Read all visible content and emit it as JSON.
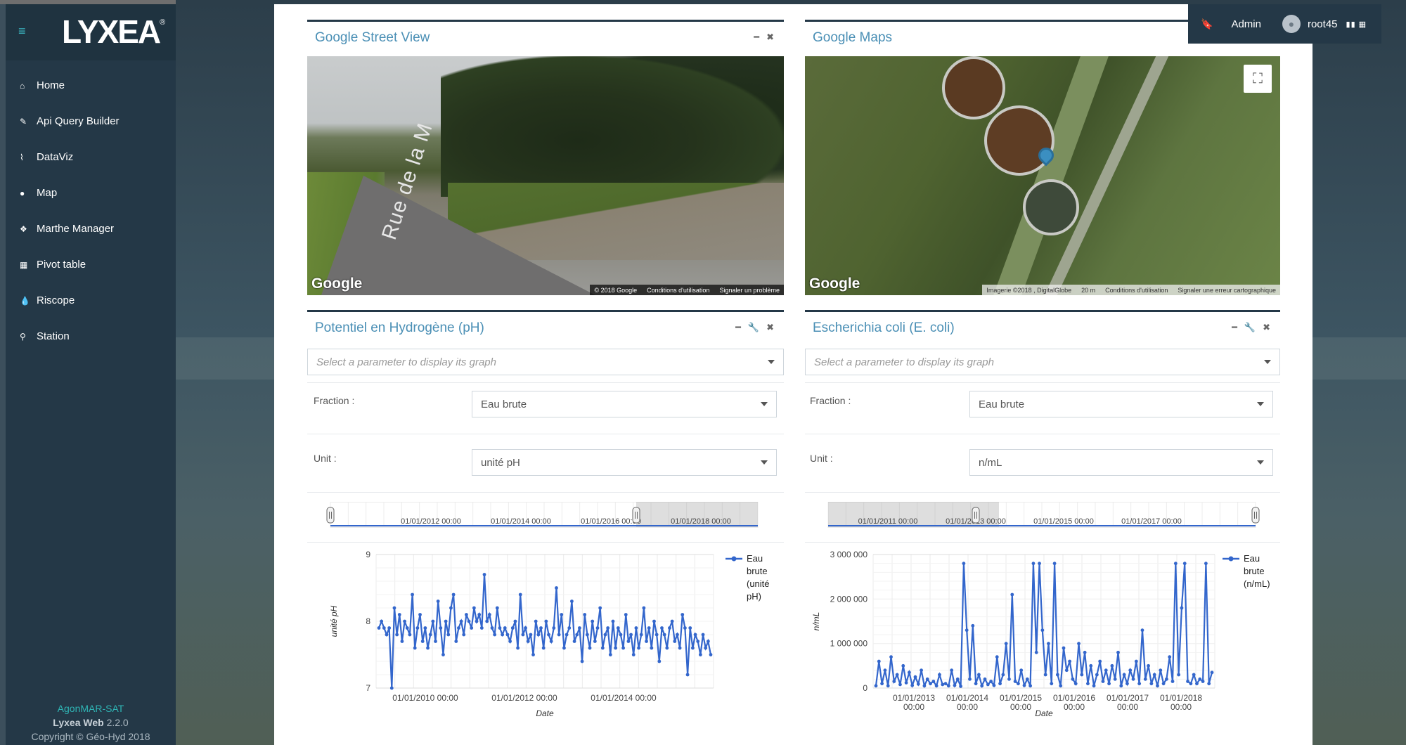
{
  "app": {
    "logo": "LYXEA",
    "project": "AgonMAR-SAT",
    "product": "Lyxea Web",
    "version": "2.2.0",
    "copyright": "Copyright © Géo-Hyd 2018"
  },
  "sidebar": {
    "items": [
      {
        "label": "Home",
        "icon": "home-icon"
      },
      {
        "label": "Api Query Builder",
        "icon": "edit-icon"
      },
      {
        "label": "DataViz",
        "icon": "line-chart-icon"
      },
      {
        "label": "Map",
        "icon": "globe-icon"
      },
      {
        "label": "Marthe Manager",
        "icon": "cubes-icon"
      },
      {
        "label": "Pivot table",
        "icon": "table-icon"
      },
      {
        "label": "Riscope",
        "icon": "drop-icon"
      },
      {
        "label": "Station",
        "icon": "map-marker-icon"
      }
    ]
  },
  "userbar": {
    "role": "Admin",
    "username": "root45"
  },
  "widgets": {
    "streetview": {
      "title": "Google Street View",
      "google": "Google",
      "attr": [
        "© 2018 Google",
        "Conditions d'utilisation",
        "Signaler un problème"
      ],
      "street": "Rue de la M"
    },
    "maps": {
      "title": "Google Maps",
      "google": "Google",
      "attr": [
        "Imagerie ©2018 , DigitalGlobe",
        "20 m",
        "Conditions d'utilisation",
        "Signaler une erreur cartographique"
      ]
    },
    "ph": {
      "title": "Potentiel en Hydrogène (pH)",
      "param_placeholder": "Select a parameter to display its graph",
      "fraction_label": "Fraction :",
      "fraction_value": "Eau brute",
      "unit_label": "Unit :",
      "unit_value": "unité pH",
      "navigator_labels": [
        "01/01/2012 00:00",
        "01/01/2014 00:00",
        "01/01/2016 00:00",
        "01/01/2018 00:00"
      ]
    },
    "ecoli": {
      "title": "Escherichia coli (E. coli)",
      "param_placeholder": "Select a parameter to display its graph",
      "fraction_label": "Fraction :",
      "fraction_value": "Eau brute",
      "unit_label": "Unit :",
      "unit_value": "n/mL",
      "navigator_labels": [
        "01/01/2011 00:00",
        "01/01/2013 00:00",
        "01/01/2015 00:00",
        "01/01/2017 00:00"
      ]
    }
  },
  "chart_data": [
    {
      "type": "line",
      "ylabel": "unité pH",
      "xlabel": "Date",
      "ylim": [
        7,
        9
      ],
      "yticks": [
        "9",
        "8",
        "7"
      ],
      "xticks": [
        "01/01/2010 00:00",
        "01/01/2012 00:00",
        "01/01/2014 00:00"
      ],
      "color": "#3366cc",
      "series": [
        {
          "name": "Eau brute (unité pH)",
          "values": [
            7.9,
            8.0,
            7.9,
            7.8,
            7.9,
            7.0,
            8.2,
            7.8,
            8.1,
            7.7,
            8.0,
            7.9,
            7.8,
            8.4,
            7.6,
            7.9,
            8.1,
            7.7,
            7.9,
            7.6,
            7.8,
            8.0,
            7.7,
            8.3,
            7.9,
            7.5,
            8.0,
            7.8,
            8.2,
            8.4,
            7.7,
            7.9,
            8.0,
            7.8,
            8.1,
            8.0,
            7.9,
            8.2,
            8.0,
            8.1,
            7.9,
            8.7,
            8.0,
            8.1,
            7.9,
            7.8,
            8.2,
            7.9,
            7.8,
            7.9,
            7.8,
            7.7,
            7.9,
            8.0,
            7.6,
            8.4,
            7.8,
            7.9,
            7.7,
            7.8,
            7.5,
            8.0,
            7.8,
            7.9,
            7.6,
            8.0,
            7.8,
            7.7,
            7.9,
            8.5,
            7.8,
            8.1,
            7.6,
            7.8,
            7.9,
            8.3,
            7.7,
            7.8,
            7.9,
            7.4,
            8.1,
            7.8,
            7.6,
            8.0,
            7.7,
            7.9,
            8.2,
            7.6,
            7.8,
            7.9,
            7.5,
            8.0,
            7.6,
            7.9,
            7.8,
            7.6,
            8.1,
            7.7,
            7.8,
            7.5,
            7.9,
            7.6,
            7.8,
            8.2,
            7.7,
            7.9,
            7.6,
            8.0,
            7.8,
            7.4,
            7.9,
            7.8,
            7.6,
            7.9,
            8.0,
            7.7,
            7.8,
            7.6,
            8.1,
            7.9,
            7.2,
            7.9,
            7.6,
            7.8,
            7.7,
            7.5,
            7.8,
            7.6,
            7.7,
            7.5
          ]
        }
      ]
    },
    {
      "type": "line",
      "ylabel": "n/mL",
      "xlabel": "Date",
      "ylim": [
        0,
        3000000
      ],
      "yticks": [
        "3 000 000",
        "2 000 000",
        "1 000 000",
        "0"
      ],
      "xticks": [
        "01/01/2013\n00:00",
        "01/01/2014\n00:00",
        "01/01/2015\n00:00",
        "01/01/2016\n00:00",
        "01/01/2017\n00:00",
        "01/01/2018\n00:00"
      ],
      "color": "#3366cc",
      "series": [
        {
          "name": "Eau brute (n/mL)",
          "values": [
            50000,
            600000,
            100000,
            400000,
            50000,
            700000,
            150000,
            300000,
            80000,
            500000,
            120000,
            350000,
            60000,
            250000,
            90000,
            400000,
            50000,
            200000,
            100000,
            150000,
            50000,
            300000,
            80000,
            100000,
            50000,
            400000,
            60000,
            200000,
            40000,
            2800000,
            1300000,
            200000,
            1400000,
            100000,
            300000,
            50000,
            200000,
            80000,
            150000,
            60000,
            700000,
            100000,
            300000,
            1000000,
            200000,
            2100000,
            150000,
            100000,
            400000,
            60000,
            200000,
            50000,
            2800000,
            800000,
            2800000,
            1300000,
            300000,
            1000000,
            100000,
            2800000,
            300000,
            50000,
            900000,
            400000,
            600000,
            200000,
            100000,
            1000000,
            300000,
            800000,
            100000,
            500000,
            50000,
            300000,
            600000,
            150000,
            400000,
            100000,
            500000,
            200000,
            800000,
            50000,
            300000,
            100000,
            400000,
            200000,
            600000,
            100000,
            1300000,
            200000,
            500000,
            100000,
            300000,
            50000,
            400000,
            100000,
            200000,
            700000,
            150000,
            2800000,
            300000,
            1800000,
            2800000,
            150000,
            100000,
            300000,
            100000,
            200000,
            150000,
            2800000,
            100000,
            350000
          ]
        }
      ]
    }
  ]
}
